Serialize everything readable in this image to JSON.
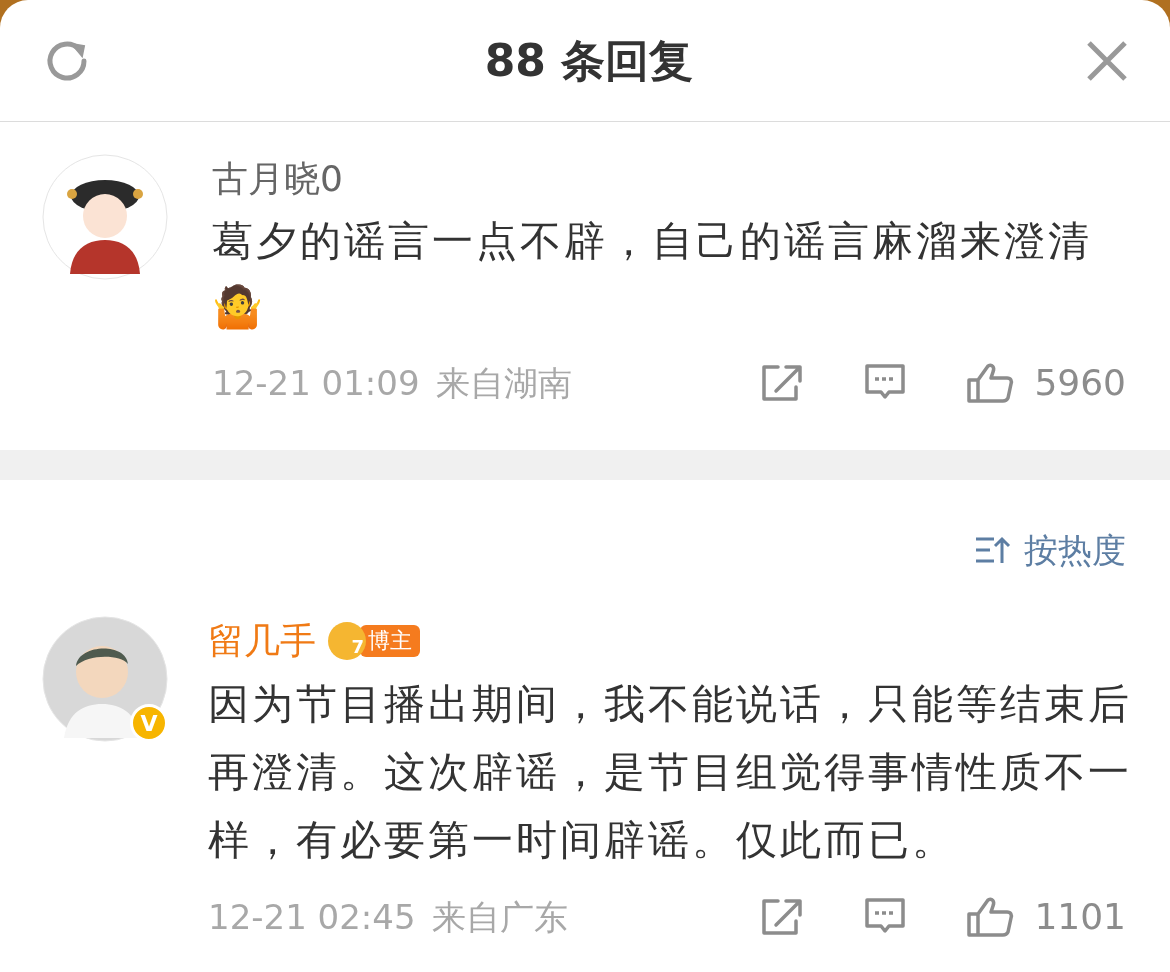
{
  "header": {
    "title": "88 条回复"
  },
  "main_comment": {
    "author": "古月晓0",
    "text": "葛夕的谣言一点不辟，自己的谣言麻溜来澄清",
    "emoji": "🤷",
    "time": "12-21 01:09",
    "location": "来自湖南",
    "likes": "5960"
  },
  "sort": {
    "label": "按热度"
  },
  "replies": [
    {
      "author": "留几手",
      "crown_number": "7",
      "badge": "博主",
      "verified": true,
      "verified_mark": "V",
      "text": "因为节目播出期间，我不能说话，只能等结束后再澄清。这次辟谣，是节目组觉得事情性质不一样，有必要第一时间辟谣。仅此而已。",
      "time": "12-21 02:45",
      "location": "来自广东",
      "likes": "1101"
    }
  ]
}
